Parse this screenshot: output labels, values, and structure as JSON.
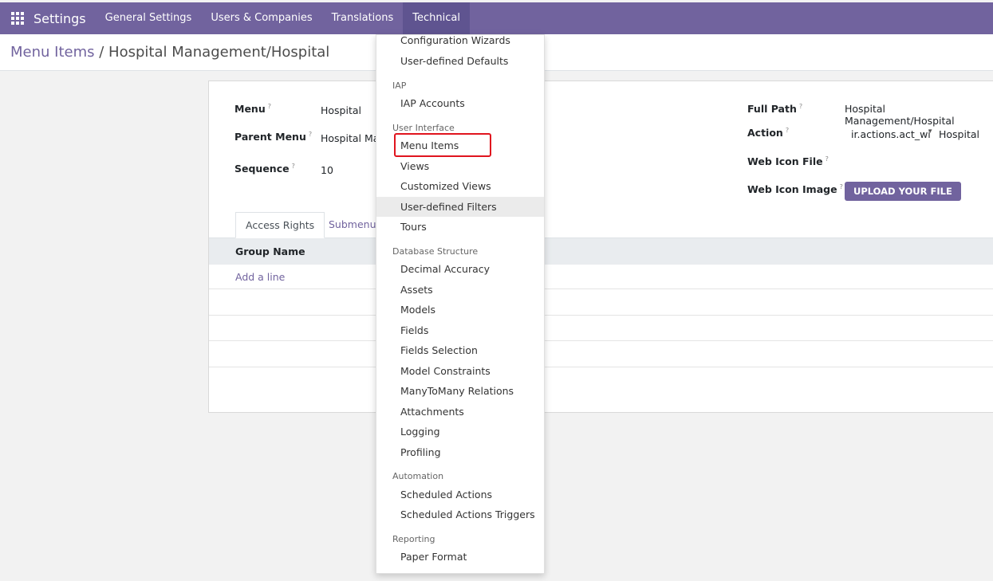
{
  "navbar": {
    "app_name": "Settings",
    "items": [
      "General Settings",
      "Users & Companies",
      "Translations",
      "Technical"
    ]
  },
  "breadcrumb": {
    "parent": "Menu Items",
    "separator": "/",
    "current": "Hospital Management/Hospital"
  },
  "form": {
    "menu_label": "Menu",
    "menu_value": "Hospital",
    "parent_menu_label": "Parent Menu",
    "parent_menu_value": "Hospital Ma",
    "sequence_label": "Sequence",
    "sequence_value": "10",
    "full_path_label": "Full Path",
    "full_path_value": "Hospital Management/Hospital",
    "action_label": "Action",
    "action_type_value": "ir.actions.act_wi",
    "action_value": "Hospital",
    "web_icon_file_label": "Web Icon File",
    "web_icon_image_label": "Web Icon Image",
    "upload_button": "UPLOAD YOUR FILE",
    "help_mark": "?"
  },
  "tabs": {
    "access_rights": "Access Rights",
    "submenus": "Submenus"
  },
  "table": {
    "group_name_header": "Group Name",
    "add_line": "Add a line"
  },
  "dropdown": {
    "config_wizards": "Configuration Wizards",
    "user_defaults": "User-defined Defaults",
    "iap_header": "IAP",
    "iap_accounts": "IAP Accounts",
    "ui_header": "User Interface",
    "menu_items": "Menu Items",
    "views": "Views",
    "customized_views": "Customized Views",
    "user_filters": "User-defined Filters",
    "tours": "Tours",
    "db_header": "Database Structure",
    "decimal_accuracy": "Decimal Accuracy",
    "assets": "Assets",
    "models": "Models",
    "fields": "Fields",
    "fields_selection": "Fields Selection",
    "model_constraints": "Model Constraints",
    "many2many": "ManyToMany Relations",
    "attachments": "Attachments",
    "logging": "Logging",
    "profiling": "Profiling",
    "automation_header": "Automation",
    "scheduled_actions": "Scheduled Actions",
    "scheduled_triggers": "Scheduled Actions Triggers",
    "reporting_header": "Reporting",
    "paper_format": "Paper Format"
  },
  "colors": {
    "brand": "#71639e",
    "highlight": "#e0141e"
  }
}
